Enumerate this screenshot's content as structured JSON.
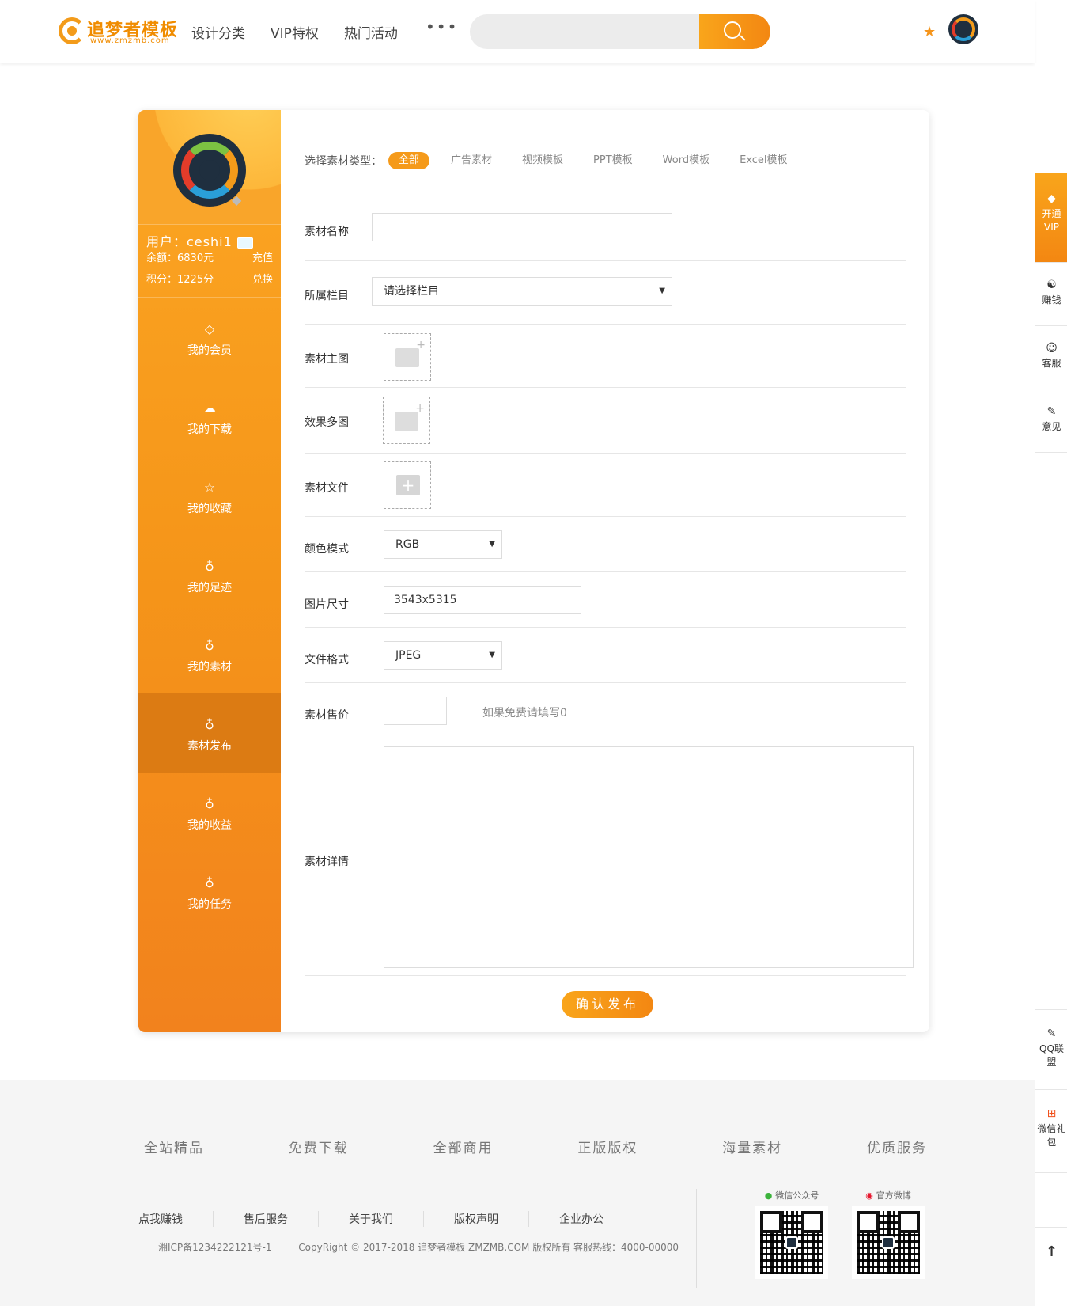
{
  "header": {
    "logo_text": "追梦者模板",
    "logo_sub": "www.zmzmb.com",
    "nav": [
      "设计分类",
      "VIP特权",
      "热门活动"
    ],
    "more": "•••",
    "search_placeholder": ""
  },
  "sidebar": {
    "user_label": "用户：ceshi1",
    "balance_label": "余额：6830元",
    "recharge": "充值",
    "points_label": "积分：1225分",
    "exchange": "兑换",
    "menu": [
      {
        "label": "我的会员",
        "icon": "◇"
      },
      {
        "label": "我的下载",
        "icon": "☁"
      },
      {
        "label": "我的收藏",
        "icon": "☆"
      },
      {
        "label": "我的足迹",
        "icon": "♁"
      },
      {
        "label": "我的素材",
        "icon": "♁"
      },
      {
        "label": "素材发布",
        "icon": "♁"
      },
      {
        "label": "我的收益",
        "icon": "♁"
      },
      {
        "label": "我的任务",
        "icon": "♁"
      }
    ]
  },
  "form": {
    "type_label": "选择素材类型：",
    "types": [
      "全部",
      "广告素材",
      "视频模板",
      "PPT模板",
      "Word模板",
      "Excel模板"
    ],
    "name_label": "素材名称",
    "name_value": "",
    "column_label": "所属栏目",
    "column_value": "请选择栏目",
    "main_image_label": "素材主图",
    "effect_images_label": "效果多图",
    "file_label": "素材文件",
    "color_mode_label": "颜色模式",
    "color_mode_value": "RGB",
    "size_label": "图片尺寸",
    "size_value": "3543x5315",
    "format_label": "文件格式",
    "format_value": "JPEG",
    "price_label": "素材售价",
    "price_value": "",
    "price_hint": "如果免费请填写0",
    "detail_label": "素材详情",
    "submit": "确认发布"
  },
  "rightbar": {
    "vip": "开通VIP",
    "earn": "赚钱",
    "service": "客服",
    "feedback": "意见",
    "qq": "QQ联盟",
    "gift": "微信礼包",
    "top": "↑"
  },
  "footer": {
    "features": [
      "全站精品",
      "免费下载",
      "全部商用",
      "正版版权",
      "海量素材",
      "优质服务"
    ],
    "links": [
      "点我赚钱",
      "售后服务",
      "关于我们",
      "版权声明",
      "企业办公"
    ],
    "icp": "湘ICP备1234222121号-1",
    "copyright": "CopyRight © 2017-2018 追梦者模板 ZMZMB.COM 版权所有 客服热线：4000-00000",
    "wechat_label": "微信公众号",
    "weibo_label": "官方微博"
  }
}
